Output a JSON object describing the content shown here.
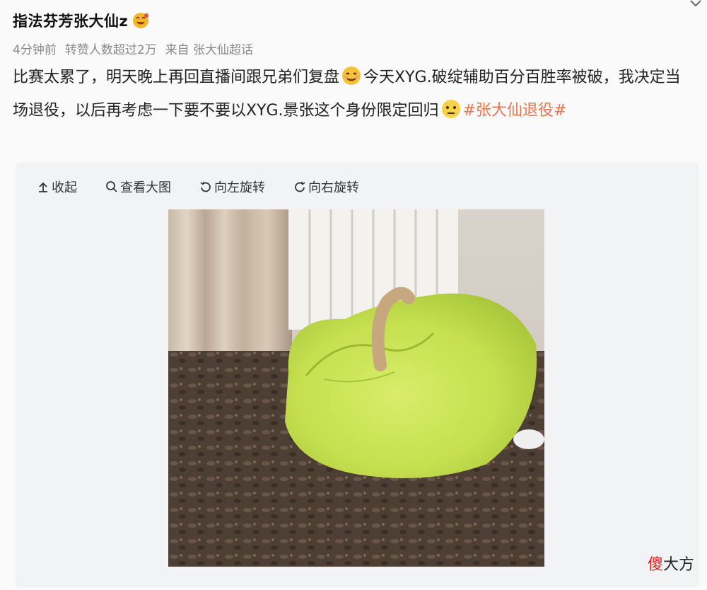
{
  "post": {
    "username": "指法芬芳张大仙z",
    "meta": {
      "time": "4分钟前",
      "reposts": "转赞人数超过2万",
      "source_prefix": "来自",
      "source": "张大仙超话"
    },
    "text_part1": "比赛太累了，明天晚上再回直播间跟兄弟们复盘",
    "text_part2": "今天XYG.破绽辅助百分百胜率被破，我决定当场退役，以后再考虑一下要不要以XYG.景张这个身份限定回归",
    "topic": "#张大仙退役#"
  },
  "toolbar": {
    "collapse": "收起",
    "view_large": "查看大图",
    "rotate_left": "向左旋转",
    "rotate_right": "向右旋转"
  },
  "watermark": {
    "first_char": "傻",
    "rest": "大方"
  },
  "colors": {
    "topic": "#eb7350",
    "meta": "#8a8a8a",
    "watermark_accent": "#d9231c"
  },
  "icons": [
    "chevron-down-icon",
    "verified-emoji-icon",
    "smirk-emoji-icon",
    "doubt-emoji-icon",
    "collapse-icon",
    "magnifier-icon",
    "rotate-left-icon",
    "rotate-right-icon"
  ]
}
